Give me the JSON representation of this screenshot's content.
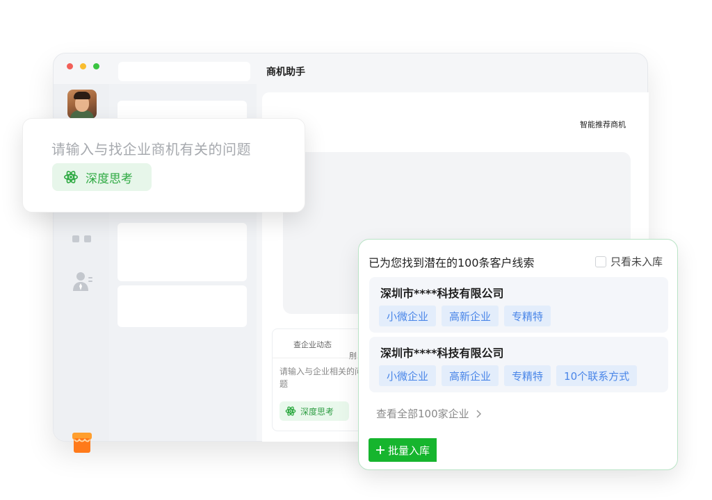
{
  "window": {
    "title": "商机助手"
  },
  "main": {
    "recommend_label": "智能推荐商机",
    "inner_card": {
      "tab": "查企业动态",
      "tab_partial": "刖",
      "input_placeholder": "请输入与企业相关的问题",
      "chip_label": "深度思考",
      "chip_icon": "atom-icon"
    }
  },
  "input_card": {
    "placeholder": "请输入与找企业商机有关的问题",
    "chip_label": "深度思考",
    "chip_icon": "atom-icon"
  },
  "results": {
    "title": "已为您找到潜在的100条客户线索",
    "filter_label": "只看未入库",
    "companies": [
      {
        "name": "深圳市****科技有限公司",
        "tags": [
          "小微企业",
          "高新企业",
          "专精特"
        ]
      },
      {
        "name": "深圳市****科技有限公司",
        "tags": [
          "小微企业",
          "高新企业",
          "专精特",
          "10个联系方式"
        ]
      }
    ],
    "view_all": "查看全部100家企业",
    "batch_button": "批量入库"
  },
  "colors": {
    "accent_green": "#16b52e",
    "chip_green": "#2faa43",
    "tag_blue": "#4a86e8"
  }
}
